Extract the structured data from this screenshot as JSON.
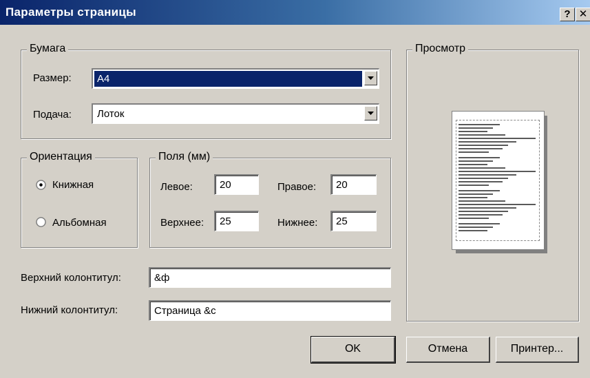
{
  "window": {
    "title": "Параметры страницы",
    "help_label": "?",
    "close_label": "✕"
  },
  "paper": {
    "legend": "Бумага",
    "size_label": "Размер:",
    "size_value": "A4",
    "feed_label": "Подача:",
    "feed_value": "Лоток"
  },
  "orientation": {
    "legend": "Ориентация",
    "portrait_label": "Книжная",
    "landscape_label": "Альбомная",
    "selected": "portrait"
  },
  "margins": {
    "legend": "Поля (мм)",
    "left_label": "Левое:",
    "left_value": "20",
    "right_label": "Правое:",
    "right_value": "20",
    "top_label": "Верхнее:",
    "top_value": "25",
    "bottom_label": "Нижнее:",
    "bottom_value": "25"
  },
  "header": {
    "label": "Верхний колонтитул:",
    "value": "&ф"
  },
  "footer": {
    "label": "Нижний колонтитул:",
    "value": "Страница &с"
  },
  "preview": {
    "legend": "Просмотр"
  },
  "buttons": {
    "ok": "OK",
    "cancel": "Отмена",
    "printer": "Принтер..."
  },
  "colors": {
    "titlebar": "#0a246a",
    "face": "#d4d0c8",
    "selection": "#0a246a"
  },
  "icons": {
    "help": "help-icon",
    "close": "close-icon",
    "dropdown": "chevron-down-icon"
  }
}
